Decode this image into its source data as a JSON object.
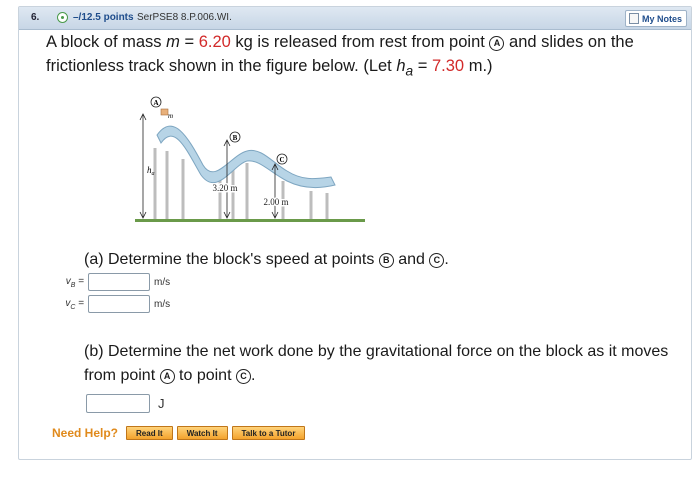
{
  "header": {
    "number": "6.",
    "status_icon": "circle-icon",
    "points": "–/12.5 points",
    "question_id": "SerPSE8 8.P.006.WI.",
    "notes_label": "My Notes"
  },
  "problem": {
    "t1": "A block of mass ",
    "m_var": "m",
    "t2": " = ",
    "mass_value": "6.20",
    "t3": " kg is released from rest from point ",
    "point_a": "A",
    "t4": " and slides on the frictionless track shown in the figure below. (Let ",
    "h_var": "h",
    "h_sub": "a",
    "t5": " = ",
    "h_value": "7.30",
    "t6": " m.)"
  },
  "figure": {
    "label_a": "A",
    "label_b": "B",
    "label_c": "C",
    "label_m": "m",
    "label_h": "h",
    "label_h_sub": "a",
    "label_320": "3.20 m",
    "label_200": "2.00 m"
  },
  "part_a": {
    "t1": "(a) Determine the block's speed at points ",
    "point_b": "B",
    "t2": " and ",
    "point_c": "C",
    "t3": ".",
    "vb_label": "v",
    "vb_sub": "B",
    "vc_label": "v",
    "vc_sub": "C",
    "eq": " =",
    "vb_value": "",
    "vc_value": "",
    "unit": "m/s"
  },
  "part_b": {
    "t1": "(b) Determine the net work done by the gravitational force on the block as it moves from point ",
    "point_a": "A",
    "t2": " to point ",
    "point_c": "C",
    "t3": ".",
    "value": "",
    "unit": "J"
  },
  "help": {
    "label": "Need Help?",
    "read": "Read It",
    "watch": "Watch It",
    "tutor": "Talk to a Tutor"
  },
  "colors": {
    "red_values": "#d22a2a",
    "header_bg": "#c7d6e6",
    "help_orange": "#e08a1c",
    "track": "#a9c7db"
  }
}
